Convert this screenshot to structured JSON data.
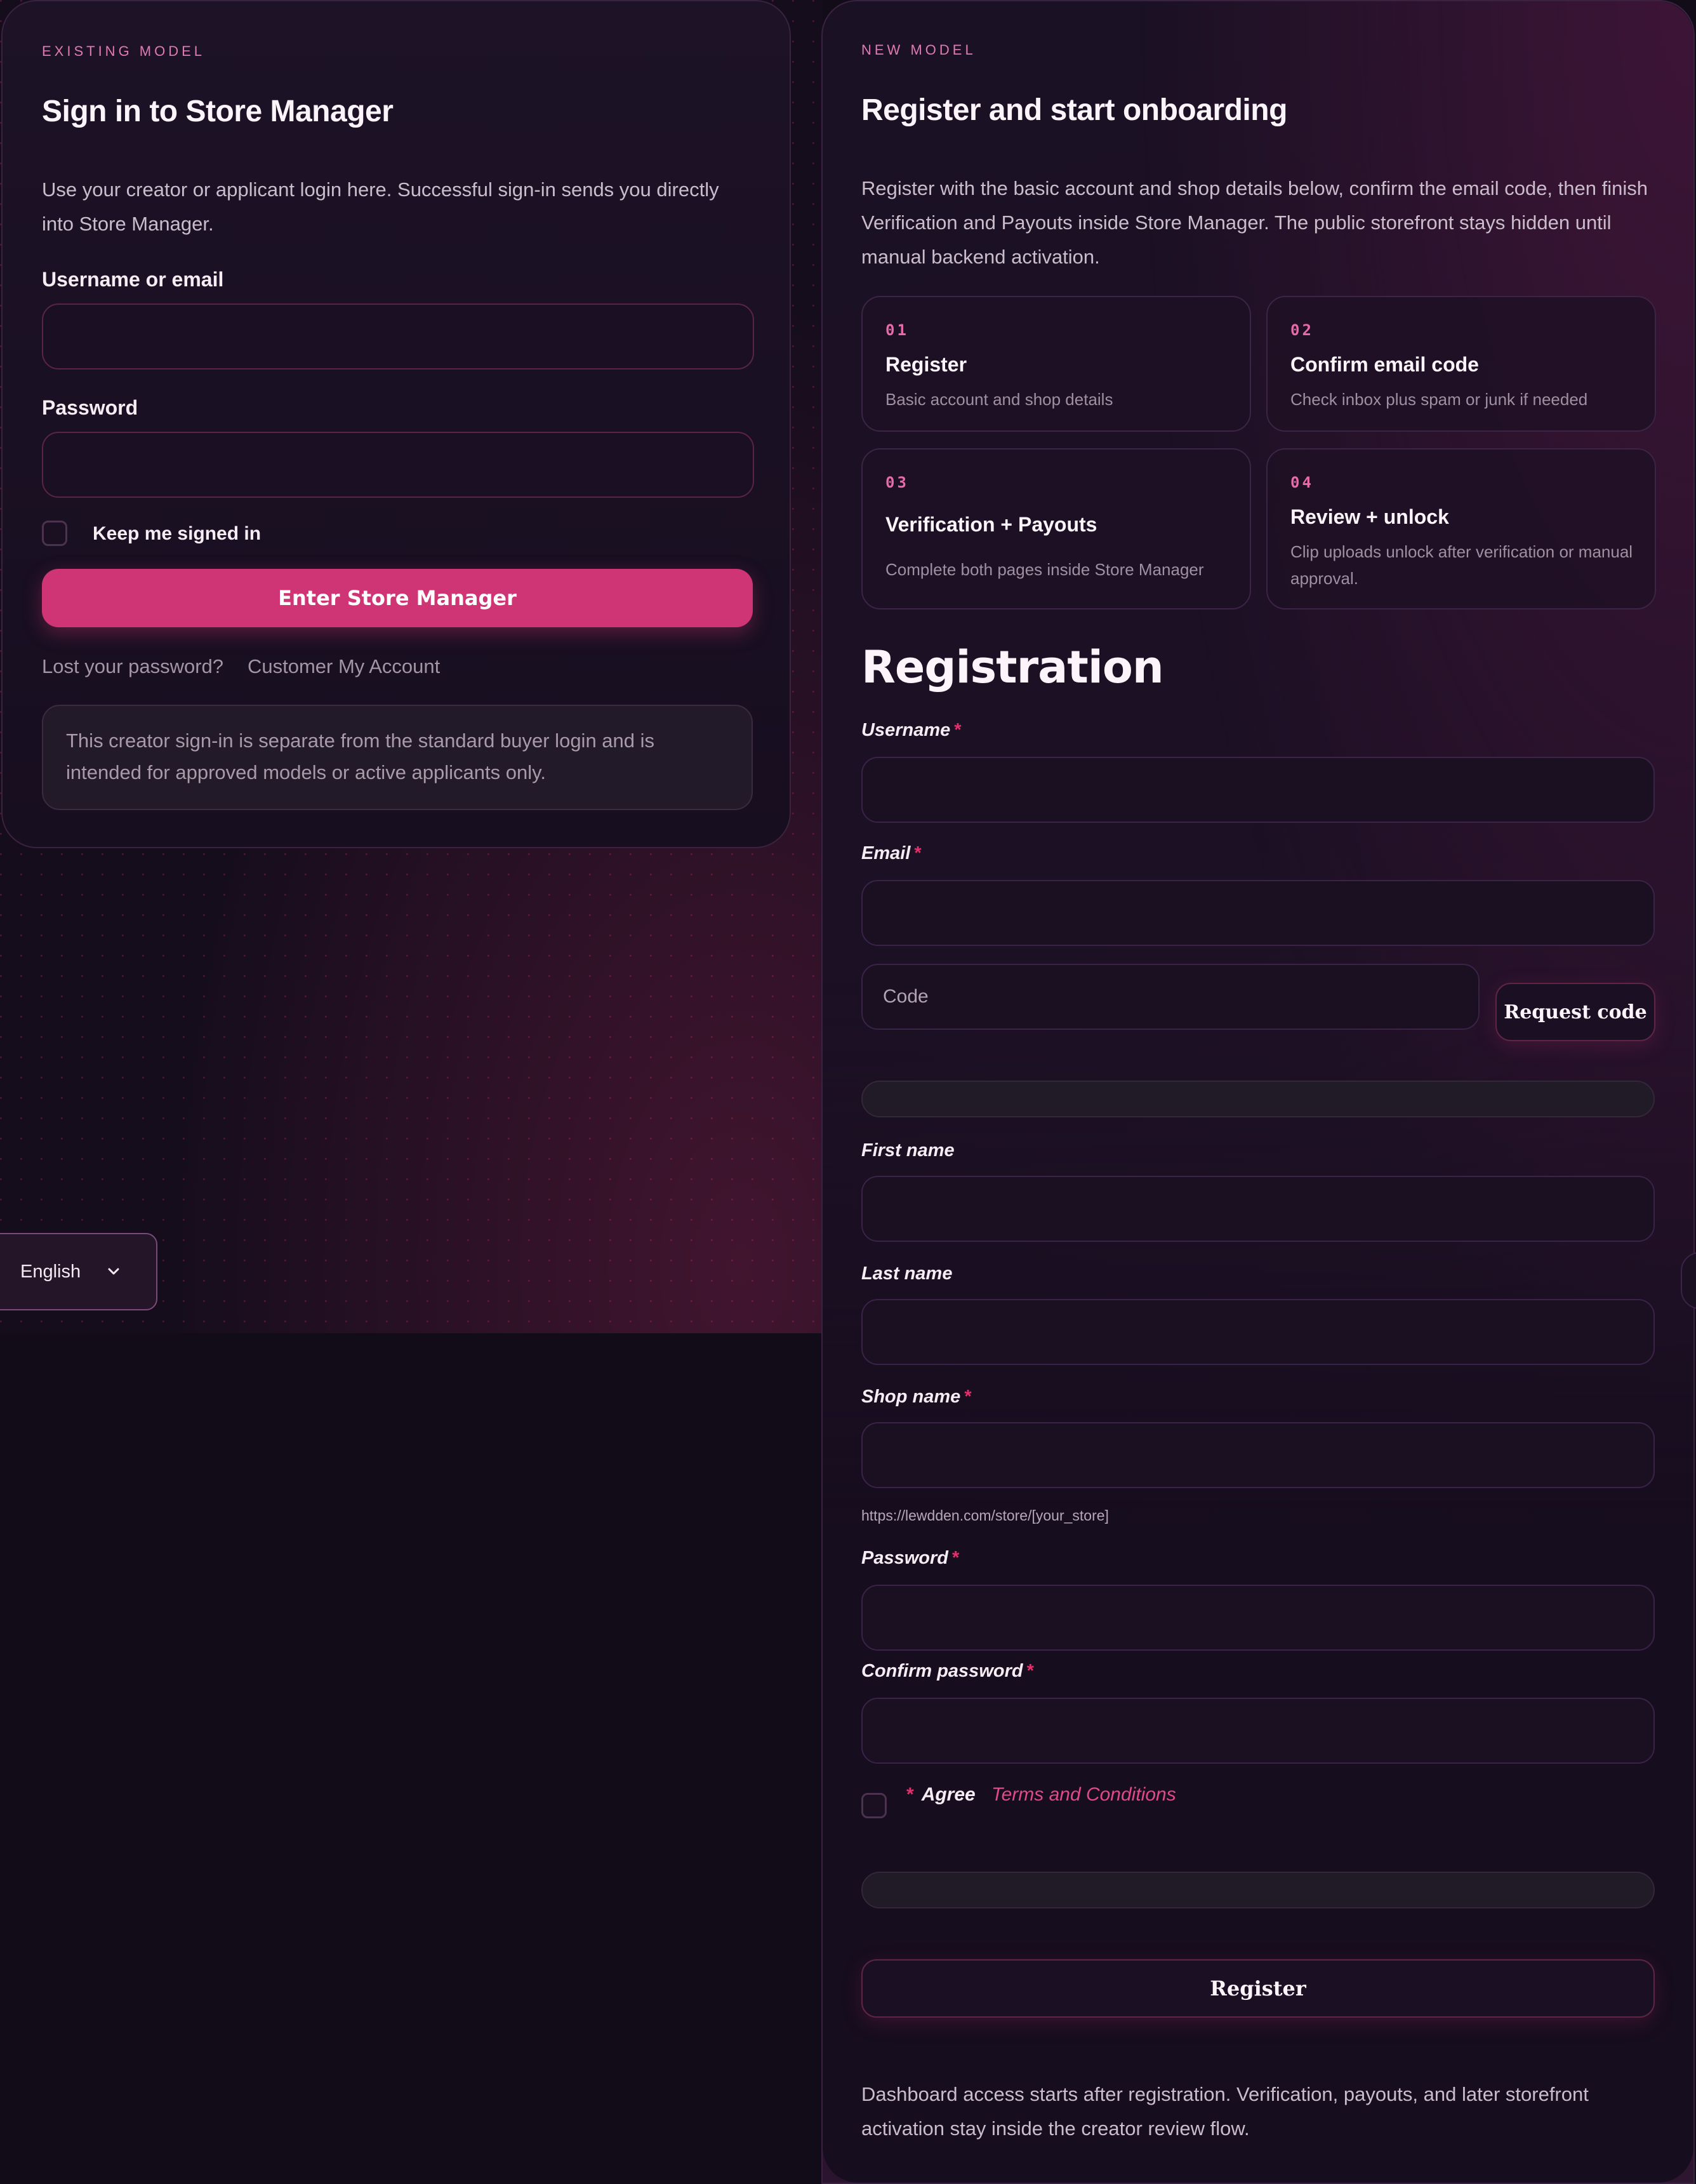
{
  "login": {
    "eyebrow": "EXISTING MODEL",
    "title": "Sign in to Store Manager",
    "description": "Use your creator or applicant login here. Successful sign-in sends you directly into Store Manager.",
    "username_label": "Username or email",
    "username_value": "",
    "password_label": "Password",
    "password_value": "",
    "remember_label": "Keep me signed in",
    "submit_label": "Enter Store Manager",
    "lost_password_link": "Lost your password?",
    "my_account_link": "Customer My Account",
    "note": "This creator sign-in is separate from the standard buyer login and is intended for approved models or active applicants only."
  },
  "language": {
    "selected": "English",
    "icon": "chevron-down-icon"
  },
  "register": {
    "eyebrow": "NEW MODEL",
    "title": "Register and start onboarding",
    "description": "Register with the basic account and shop details below, confirm the email code, then finish Verification and Payouts inside Store Manager. The public storefront stays hidden until manual backend activation.",
    "steps": [
      {
        "num": "01",
        "title": "Register",
        "desc": "Basic account and shop details"
      },
      {
        "num": "02",
        "title": "Confirm email code",
        "desc": "Check inbox plus spam or junk if needed"
      },
      {
        "num": "03",
        "title": "Verification + Payouts",
        "desc": "Complete both pages inside Store Manager"
      },
      {
        "num": "04",
        "title": "Review + unlock",
        "desc": "Clip uploads unlock after verification or manual approval."
      }
    ],
    "form_title": "Registration",
    "required_mark": "*",
    "fields": {
      "username_label": "Username",
      "email_label": "Email",
      "code_placeholder": "Code",
      "request_code_label": "Request code",
      "first_name_label": "First name",
      "last_name_label": "Last name",
      "shop_name_label": "Shop name",
      "shop_url_hint": "https://lewdden.com/store/[your_store]",
      "password_label": "Password",
      "confirm_password_label": "Confirm password"
    },
    "agree_label": "Agree",
    "terms_link": "Terms and Conditions",
    "submit_label": "Register",
    "footer_note": "Dashboard access starts after registration. Verification, payouts, and later storefront activation stay inside the creator review flow."
  }
}
